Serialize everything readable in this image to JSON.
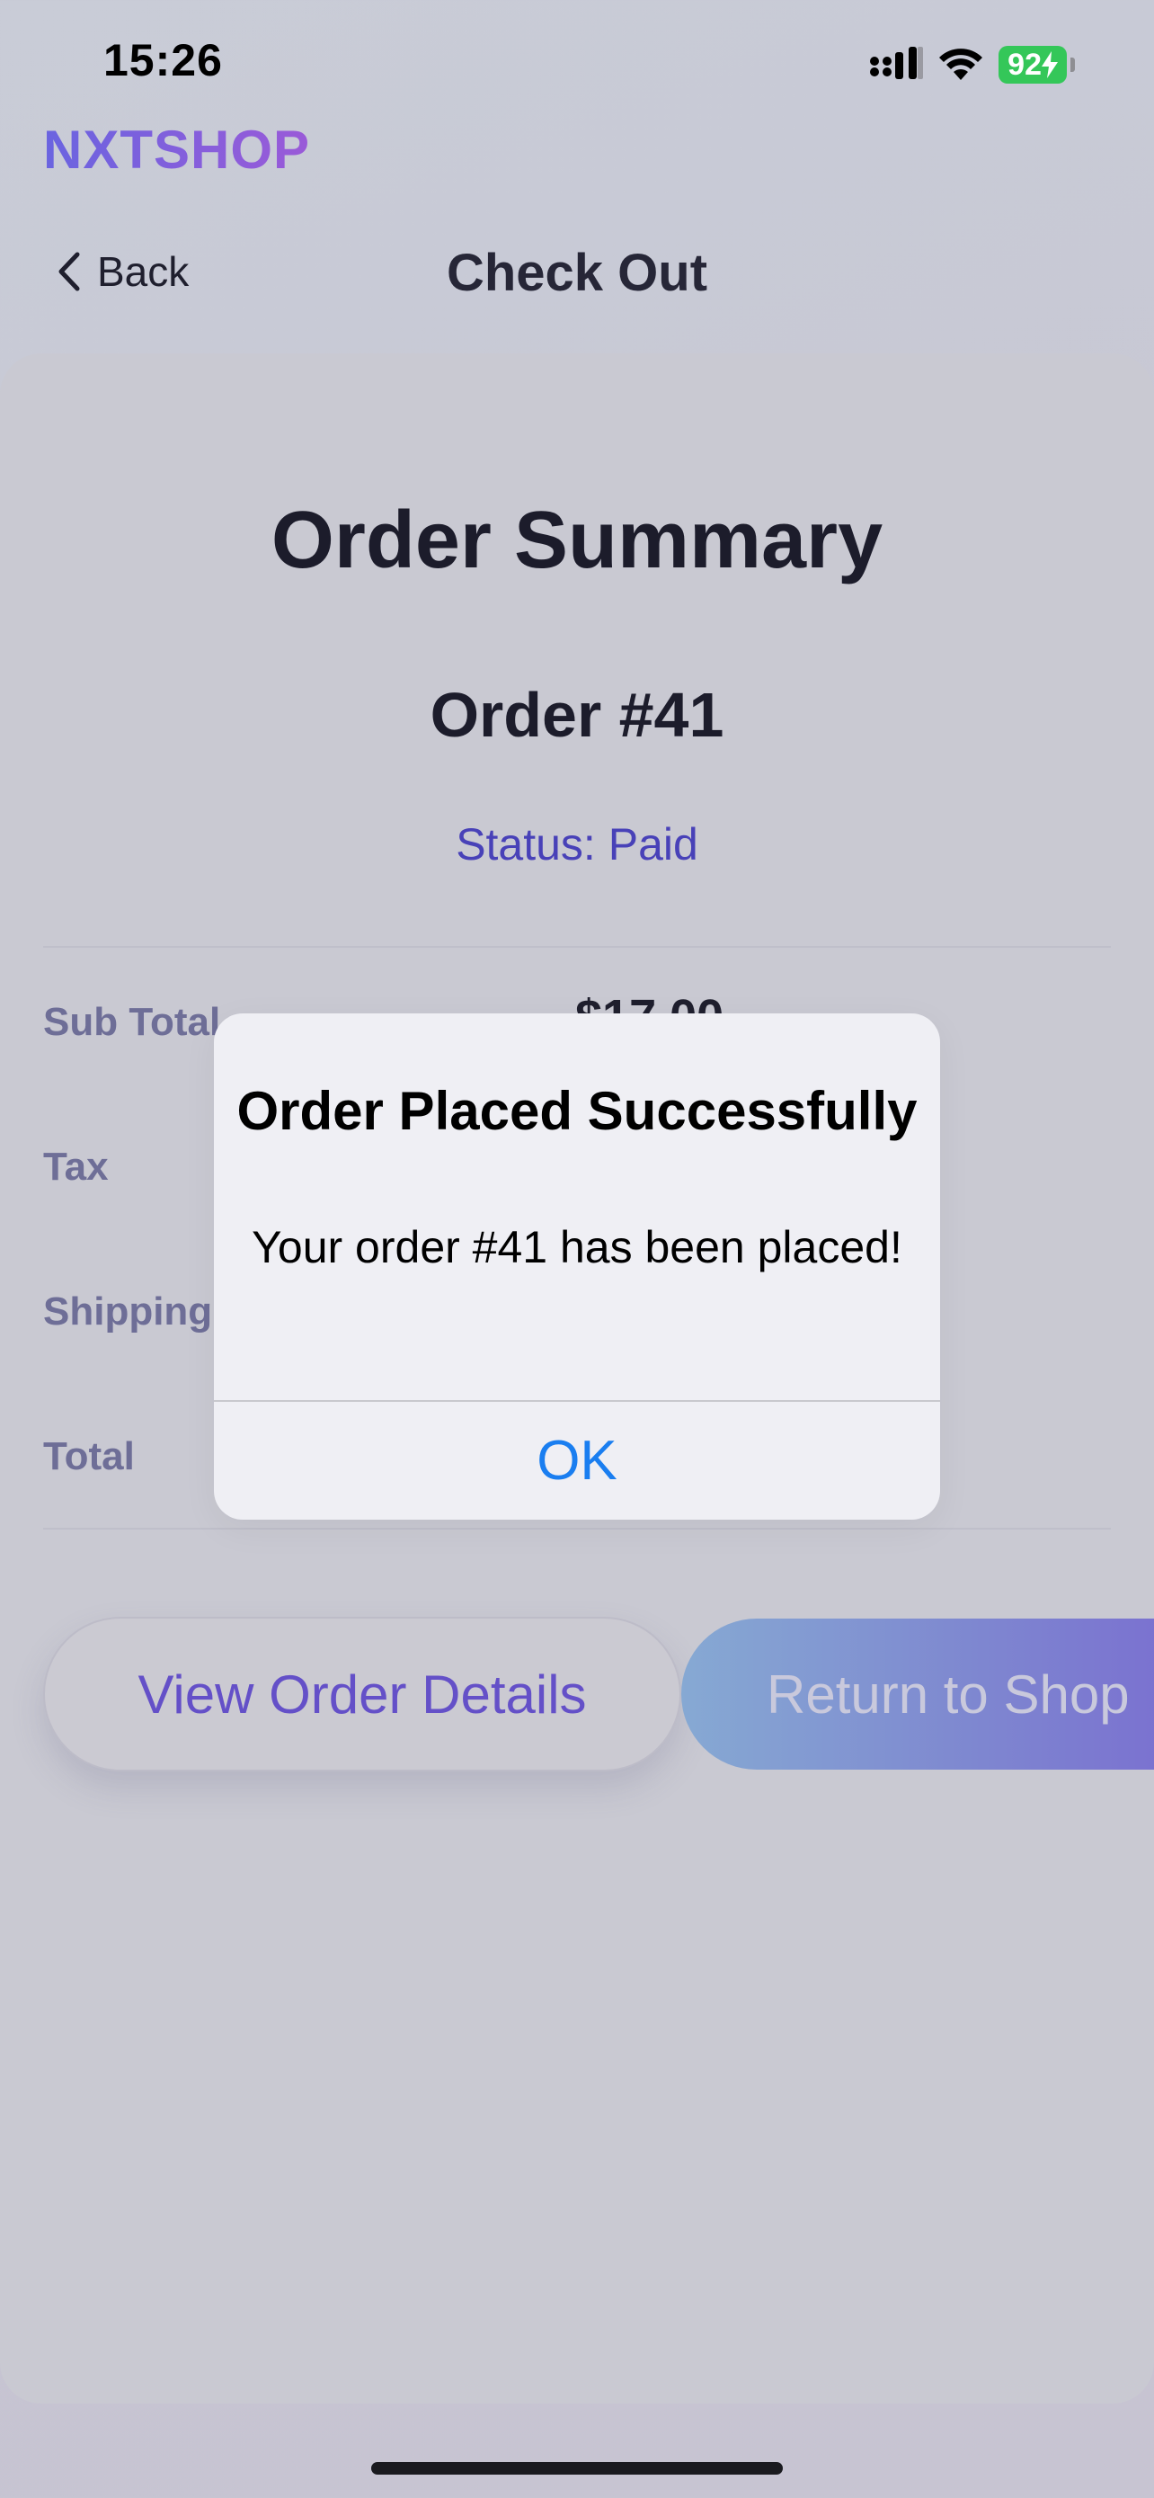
{
  "status_bar": {
    "time": "15:26",
    "battery": "92"
  },
  "header": {
    "brand": "NXTSHOP",
    "back_label": "Back",
    "title": "Check Out"
  },
  "summary": {
    "heading": "Order Summary",
    "order_number": "Order #41",
    "status": "Status: Paid",
    "rows": [
      {
        "label": "Sub Total",
        "value": "$17.00"
      },
      {
        "label": "Tax",
        "value": ""
      },
      {
        "label": "Shipping",
        "value": ""
      },
      {
        "label": "Total",
        "value": ""
      }
    ]
  },
  "buttons": {
    "view_details": "View Order Details",
    "return_shop": "Return to Shop"
  },
  "alert": {
    "title": "Order Placed Successfully",
    "message": "Your order #41 has been placed!",
    "ok": "OK"
  },
  "colors": {
    "accent": "#4841b8",
    "ios_blue": "#1a7ef0",
    "battery_green": "#34c759"
  }
}
